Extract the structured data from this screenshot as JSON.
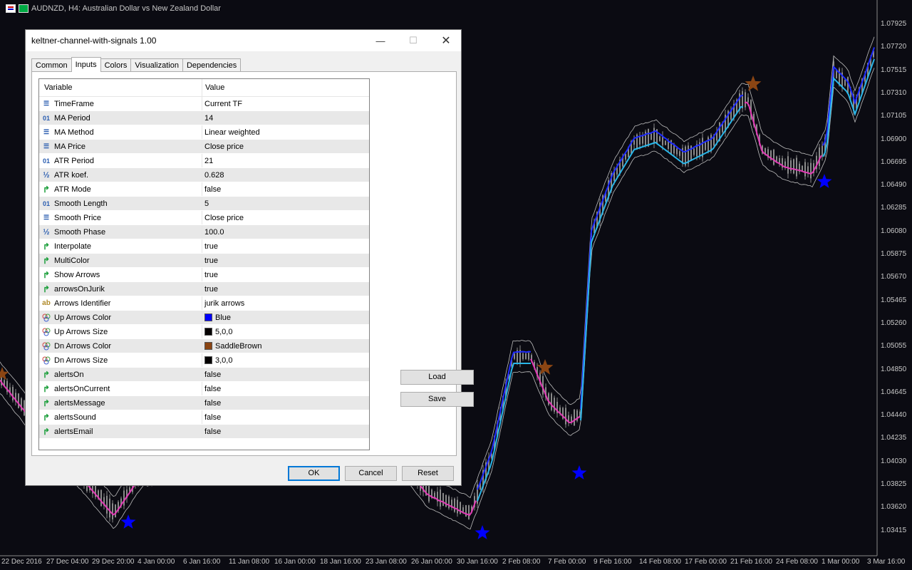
{
  "window": {
    "symbol_title": "AUDNZD, H4:  Australian Dollar vs New Zealand Dollar"
  },
  "price_axis": [
    "1.07925",
    "1.07720",
    "1.07515",
    "1.07310",
    "1.07105",
    "1.06900",
    "1.06695",
    "1.06490",
    "1.06285",
    "1.06080",
    "1.05875",
    "1.05670",
    "1.05465",
    "1.05260",
    "1.05055",
    "1.04850",
    "1.04645",
    "1.04440",
    "1.04235",
    "1.04030",
    "1.03825",
    "1.03620",
    "1.03415"
  ],
  "time_axis": [
    "22 Dec 2016",
    "27 Dec 04:00",
    "29 Dec 20:00",
    "4 Jan 00:00",
    "6 Jan 16:00",
    "11 Jan 08:00",
    "16 Jan 00:00",
    "18 Jan 16:00",
    "23 Jan 08:00",
    "26 Jan 00:00",
    "30 Jan 16:00",
    "2 Feb 08:00",
    "7 Feb 00:00",
    "9 Feb 16:00",
    "14 Feb 08:00",
    "17 Feb 00:00",
    "21 Feb 16:00",
    "24 Feb 08:00",
    "1 Mar 00:00",
    "3 Mar 16:00"
  ],
  "dialog": {
    "title": "keltner-channel-with-signals 1.00",
    "tabs": [
      "Common",
      "Inputs",
      "Colors",
      "Visualization",
      "Dependencies"
    ],
    "active_tab": "Inputs",
    "columns": {
      "variable": "Variable",
      "value": "Value"
    },
    "inputs": [
      {
        "name": "TimeFrame",
        "value": "Current TF",
        "type": "enum"
      },
      {
        "name": "MA Period",
        "value": "14",
        "type": "int"
      },
      {
        "name": "MA Method",
        "value": "Linear weighted",
        "type": "enum"
      },
      {
        "name": "MA Price",
        "value": "Close price",
        "type": "enum"
      },
      {
        "name": "ATR Period",
        "value": "21",
        "type": "int"
      },
      {
        "name": "ATR koef.",
        "value": "0.628",
        "type": "double"
      },
      {
        "name": "ATR Mode",
        "value": "false",
        "type": "bool"
      },
      {
        "name": "Smooth Length",
        "value": "5",
        "type": "int"
      },
      {
        "name": "Smooth Price",
        "value": "Close price",
        "type": "enum"
      },
      {
        "name": "Smooth Phase",
        "value": "100.0",
        "type": "double"
      },
      {
        "name": "Interpolate",
        "value": "true",
        "type": "bool"
      },
      {
        "name": "MultiColor",
        "value": "true",
        "type": "bool"
      },
      {
        "name": "Show Arrows",
        "value": "true",
        "type": "bool"
      },
      {
        "name": "arrowsOnJurik",
        "value": "true",
        "type": "bool"
      },
      {
        "name": "Arrows Identifier",
        "value": "jurik arrows",
        "type": "string"
      },
      {
        "name": "Up Arrows Color",
        "value": "Blue",
        "type": "color",
        "swatch": "#0000ff"
      },
      {
        "name": "Up Arrows Size",
        "value": "5,0,0",
        "type": "color",
        "swatch": "#050000"
      },
      {
        "name": "Dn Arrows Color",
        "value": "SaddleBrown",
        "type": "color",
        "swatch": "#8b4513"
      },
      {
        "name": "Dn Arrows Size",
        "value": "3,0,0",
        "type": "color",
        "swatch": "#030000"
      },
      {
        "name": "alertsOn",
        "value": "false",
        "type": "bool"
      },
      {
        "name": "alertsOnCurrent",
        "value": "false",
        "type": "bool"
      },
      {
        "name": "alertsMessage",
        "value": "false",
        "type": "bool"
      },
      {
        "name": "alertsSound",
        "value": "false",
        "type": "bool"
      },
      {
        "name": "alertsEmail",
        "value": "false",
        "type": "bool"
      }
    ],
    "buttons": {
      "load": "Load",
      "save": "Save",
      "ok": "OK",
      "cancel": "Cancel",
      "reset": "Reset"
    }
  },
  "colors": {
    "chart_bg": "#0b0b12",
    "candles": "#8a8a8a",
    "upper_line": "#1e2bff",
    "mid_line": "#29b6e8",
    "down_line": "#e23ab5",
    "channel": "#bdbdbd",
    "up_arrow": "#0000ff",
    "dn_arrow": "#8b4513"
  }
}
